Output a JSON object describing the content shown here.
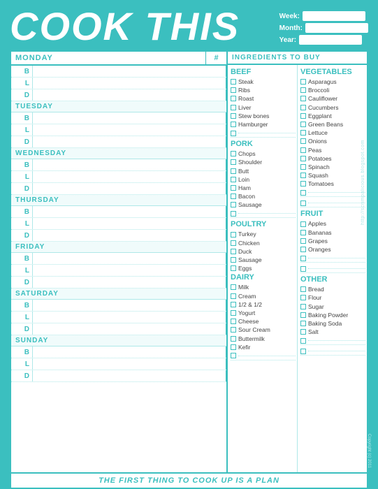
{
  "header": {
    "title": "COOK THIS",
    "fields": [
      {
        "label": "Week:",
        "value": ""
      },
      {
        "label": "Month:",
        "value": ""
      },
      {
        "label": "Year:",
        "value": ""
      }
    ]
  },
  "days_header": {
    "day": "MONDAY",
    "hash": "#"
  },
  "days": [
    {
      "name": "MONDAY",
      "meals": [
        "B",
        "L",
        "D"
      ]
    },
    {
      "name": "TUESDAY",
      "meals": [
        "B",
        "L",
        "D"
      ]
    },
    {
      "name": "WEDNESDAY",
      "meals": [
        "B",
        "L",
        "D"
      ]
    },
    {
      "name": "THURSDAY",
      "meals": [
        "B",
        "L",
        "D"
      ]
    },
    {
      "name": "FRIDAY",
      "meals": [
        "B",
        "L",
        "D"
      ]
    },
    {
      "name": "SATURDAY",
      "meals": [
        "B",
        "L",
        "D"
      ]
    },
    {
      "name": "SUNDAY",
      "meals": [
        "B",
        "L",
        "D"
      ]
    }
  ],
  "ingredients_header": "INGREDIENTS TO BUY",
  "sections": {
    "left": [
      {
        "title": "BEEF",
        "items": [
          "Steak",
          "Ribs",
          "Roast",
          "Liver",
          "Stew bones",
          "Hamburger"
        ],
        "blanks": 1
      },
      {
        "title": "PORK",
        "items": [
          "Chops",
          "Shoulder",
          "Butt",
          "Loin",
          "Ham",
          "Bacon",
          "Sausage"
        ],
        "blanks": 1
      },
      {
        "title": "POULTRY",
        "items": [
          "Turkey",
          "Chicken",
          "Duck",
          "Sausage",
          "Eggs"
        ],
        "blanks": 0
      },
      {
        "title": "DAIRY",
        "items": [
          "Milk",
          "Cream",
          "1/2 & 1/2",
          "Yogurt",
          "Cheese",
          "Sour Cream",
          "Buttermilk",
          "Kefir"
        ],
        "blanks": 1
      }
    ],
    "right": [
      {
        "title": "VEGETABLES",
        "items": [
          "Asparagus",
          "Broccoli",
          "Cauliflower",
          "Cucumbers",
          "Eggplant",
          "Green Beans",
          "Lettuce",
          "Onions",
          "Peas",
          "Potatoes",
          "Spinach",
          "Squash",
          "Tomatoes"
        ],
        "blanks": 2
      },
      {
        "title": "FRUIT",
        "items": [
          "Apples",
          "Bananas",
          "Grapes",
          "Oranges"
        ],
        "blanks": 2
      },
      {
        "title": "OTHER",
        "items": [
          "Bread",
          "Flour",
          "Sugar",
          "Baking Powder",
          "Baking Soda",
          "Salt"
        ],
        "blanks": 2
      }
    ]
  },
  "footer": "THE FIRST THING TO COOK UP IS A PLAN",
  "watermark": "http://scrimpalicious.blogspot.com",
  "copyright": "Copyright (c) 2011"
}
